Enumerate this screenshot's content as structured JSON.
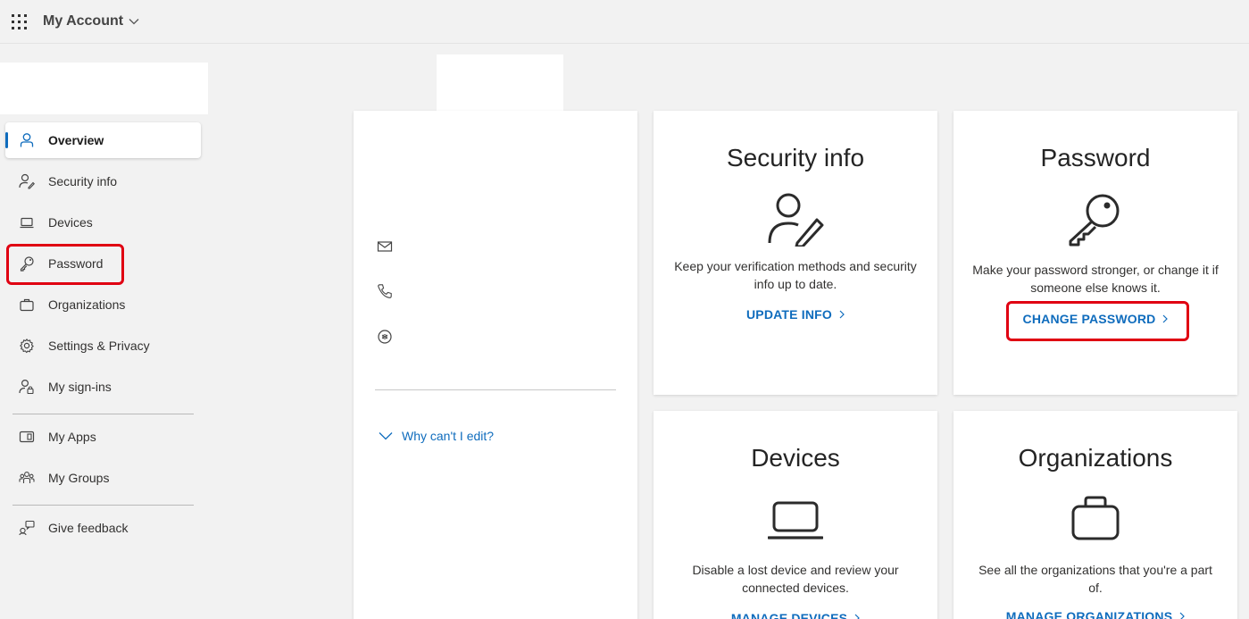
{
  "header": {
    "app_title": "My Account"
  },
  "sidebar": {
    "items": [
      {
        "label": "Overview",
        "icon": "person-icon"
      },
      {
        "label": "Security info",
        "icon": "person-key-icon"
      },
      {
        "label": "Devices",
        "icon": "laptop-icon"
      },
      {
        "label": "Password",
        "icon": "key-icon"
      },
      {
        "label": "Organizations",
        "icon": "briefcase-icon"
      },
      {
        "label": "Settings & Privacy",
        "icon": "gear-icon"
      },
      {
        "label": "My sign-ins",
        "icon": "person-lock-icon"
      },
      {
        "label": "My Apps",
        "icon": "apps-icon"
      },
      {
        "label": "My Groups",
        "icon": "people-icon"
      },
      {
        "label": "Give feedback",
        "icon": "feedback-icon"
      }
    ]
  },
  "profile": {
    "why_cant_edit": "Why can't I edit?"
  },
  "tiles": {
    "security": {
      "title": "Security info",
      "description": "Keep your verification methods and security info up to date.",
      "link": "UPDATE INFO"
    },
    "password": {
      "title": "Password",
      "description": "Make your password stronger, or change it if someone else knows it.",
      "link": "CHANGE PASSWORD"
    },
    "devices": {
      "title": "Devices",
      "description": "Disable a lost device and review your connected devices.",
      "link": "MANAGE DEVICES"
    },
    "organizations": {
      "title": "Organizations",
      "description": "See all the organizations that you're a part of.",
      "link": "MANAGE ORGANIZATIONS"
    }
  },
  "colors": {
    "accent": "#0f6cbd",
    "highlight": "#e00012",
    "background": "#f2f2f2"
  }
}
